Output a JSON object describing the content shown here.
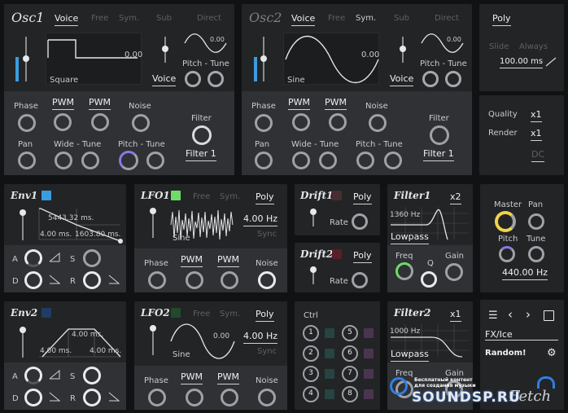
{
  "osc1": {
    "title": "Osc1",
    "mode_voice": "Voice",
    "mode_free": "Free",
    "mode_sym": "Sym.",
    "sub": "Sub",
    "direct": "Direct",
    "wave_value": "0.00",
    "wave_name": "Square",
    "sub_value": "0.00",
    "pitch_tune": "Pitch - Tune",
    "sub_voice": "Voice",
    "phase": "Phase",
    "pwm1": "PWM",
    "pwm2": "PWM",
    "noise": "Noise",
    "pan": "Pan",
    "wide_tune": "Wide - Tune",
    "pitch_tune2": "Pitch - Tune",
    "filter": "Filter",
    "filter_value": "Filter 1"
  },
  "osc2": {
    "title": "Osc2",
    "mode_voice": "Voice",
    "mode_free": "Free",
    "mode_sym": "Sym.",
    "sub": "Sub",
    "direct": "Direct",
    "wave_value": "0.00",
    "wave_name": "Sine",
    "sub_value": "0.00",
    "pitch_tune": "Pitch - Tune",
    "sub_voice": "Voice",
    "phase": "Phase",
    "pwm1": "PWM",
    "pwm2": "PWM",
    "noise": "Noise",
    "pan": "Pan",
    "wide_tune": "Wide - Tune",
    "pitch_tune2": "Pitch - Tune",
    "filter": "Filter",
    "filter_value": "Filter 1"
  },
  "voice": {
    "poly": "Poly",
    "slide": "Slide",
    "always": "Always",
    "time": "100.00 ms",
    "quality": "Quality",
    "quality_value": "x1",
    "render": "Render",
    "render_value": "x1",
    "dc": "DC"
  },
  "env1": {
    "title": "Env1",
    "value1": "5443.32 ms.",
    "value2": "4.00 ms.",
    "value3": "1603.80 ms.",
    "a": "A",
    "s": "S",
    "d": "D",
    "r": "R",
    "color": "#3b9de0"
  },
  "env2": {
    "title": "Env2",
    "value1": "4.00 ms.",
    "value2": "4.00 ms.",
    "value3": "4.00 ms.",
    "a": "A",
    "s": "S",
    "d": "D",
    "r": "R",
    "color": "#1f3c63"
  },
  "lfo1": {
    "title": "LFO1",
    "free": "Free",
    "sym": "Sym.",
    "poly": "Poly",
    "rate": "4.00 Hz",
    "sync": "Sync",
    "wave_name": "Sine",
    "phase": "Phase",
    "pwm1": "PWM",
    "pwm2": "PWM",
    "noise": "Noise",
    "color": "#6fdc6a"
  },
  "lfo2": {
    "title": "LFO2",
    "free": "Free",
    "sym": "Sym.",
    "poly": "Poly",
    "rate": "4.00 Hz",
    "sync": "Sync",
    "wave_name": "Sine",
    "wave_value": "0.00",
    "phase": "Phase",
    "pwm1": "PWM",
    "pwm2": "PWM",
    "noise": "Noise",
    "color": "#22492a"
  },
  "drift1": {
    "title": "Drift1",
    "poly": "Poly",
    "rate": "Rate",
    "color": "#4a2c33"
  },
  "drift2": {
    "title": "Drift2",
    "poly": "Poly",
    "rate": "Rate",
    "color": "#5a1d29"
  },
  "ctrl": {
    "title": "Ctrl",
    "numbers": [
      "1",
      "2",
      "3",
      "4",
      "5",
      "6",
      "7",
      "8"
    ]
  },
  "filter1": {
    "title": "Filter1",
    "mult": "x2",
    "freq_label": "1360 Hz",
    "type": "Lowpass",
    "freq": "Freq",
    "q": "Q",
    "gain": "Gain"
  },
  "filter2": {
    "title": "Filter2",
    "mult": "x1",
    "freq_label": "1000 Hz",
    "type": "Lowpass",
    "freq": "Freq",
    "gain": "Gain"
  },
  "master": {
    "master": "Master",
    "pan": "Pan",
    "pitch": "Pitch",
    "tune": "Tune",
    "frequency": "440.00 Hz"
  },
  "preset": {
    "name": "FX/Ice",
    "random": "Random!"
  },
  "watermark": {
    "line1": "Бесплатный контент",
    "line2": "для создания музыки",
    "brand": "SOUNDSP.RU",
    "signature": "Fetch"
  }
}
